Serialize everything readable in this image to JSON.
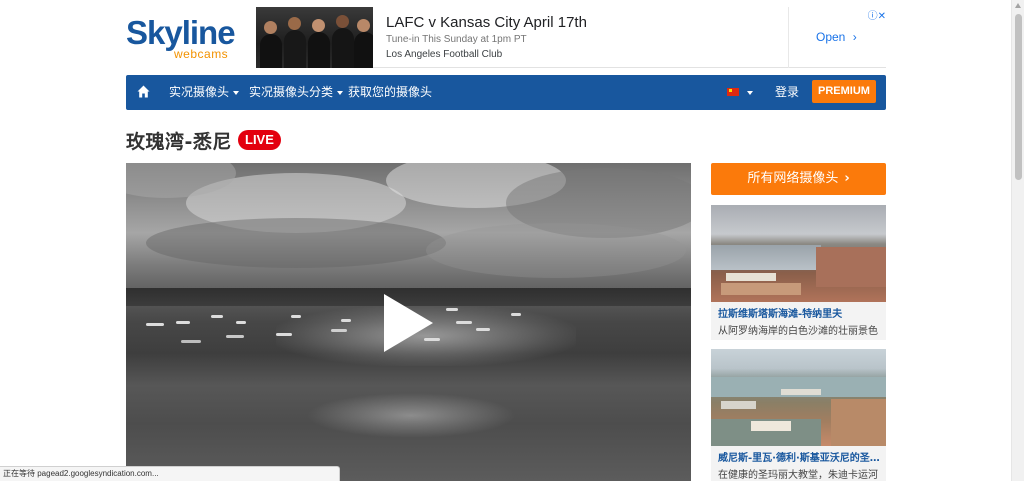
{
  "logo": {
    "word": "Skyline",
    "sub": "webcams"
  },
  "ad": {
    "title": "LAFC v Kansas City April 17th",
    "line2": "Tune-in This Sunday at 1pm PT",
    "line3": "Los Angeles Football Club",
    "cta": "Open",
    "close_glyph": "ⓘ✕"
  },
  "nav": {
    "live_cams": "实况摄像头",
    "categories": "实况摄像头分类",
    "get_cam": "获取您的摄像头",
    "login": "登录",
    "premium": "PREMIUM"
  },
  "page": {
    "title": "玫瑰湾-悉尼",
    "live_badge": "LIVE"
  },
  "sidebar": {
    "all_cams": "所有网络摄像头",
    "cards": [
      {
        "title": "拉斯维斯塔斯海滩-特纳里夫",
        "desc": "从阿罗纳海岸的白色沙滩的壮丽景色"
      },
      {
        "title": "威尼斯-里瓦·德利·斯基亚沃尼的圣…",
        "desc": "在健康的圣玛丽大教堂，朱迪卡运河"
      }
    ]
  },
  "status_bar": {
    "text": "正在等待 pagead2.googlesyndication.com..."
  },
  "colors": {
    "brand_blue": "#18579e",
    "accent_orange": "#fb7a0b",
    "live_red": "#e3000f"
  }
}
